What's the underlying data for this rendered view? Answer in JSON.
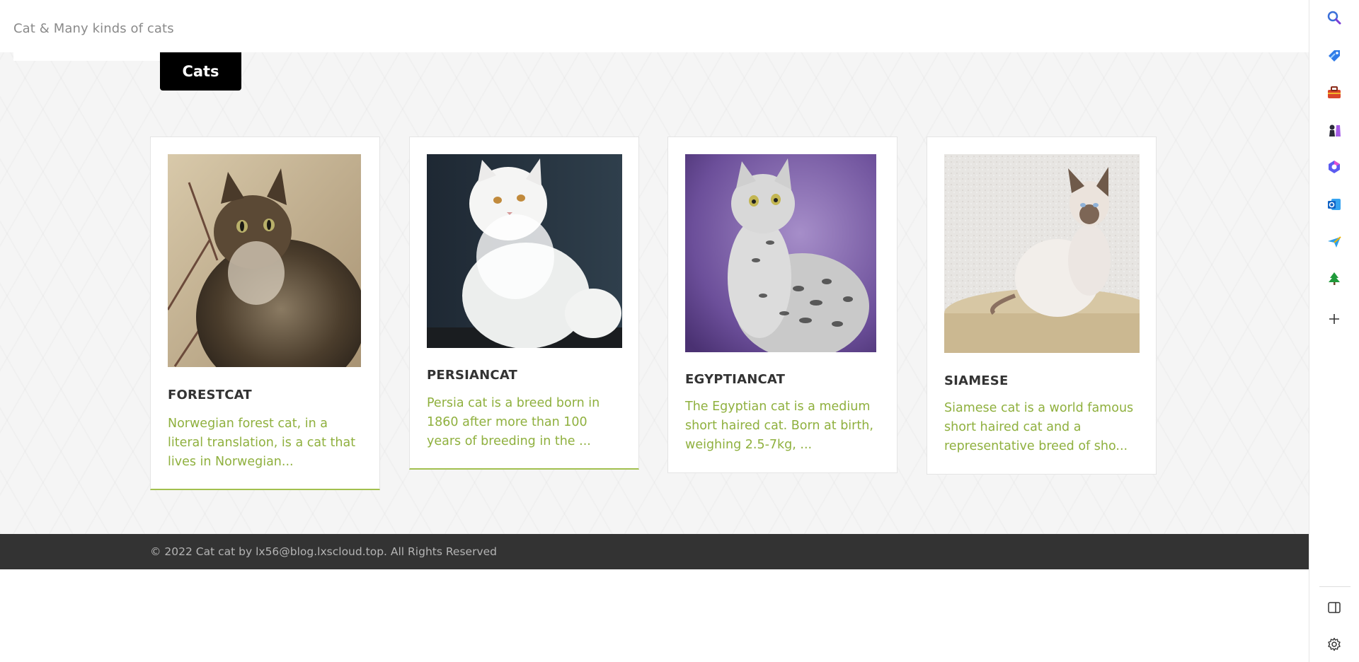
{
  "header": {
    "site_title": "Cat & Many kinds of cats"
  },
  "nav": {
    "category_tab": "Cats"
  },
  "cards": [
    {
      "title": "FORESTCAT",
      "desc": "Norwegian forest cat, in a literal translation, is a cat that lives in Norwegian..."
    },
    {
      "title": "PERSIANCAT",
      "desc": "Persia cat is a breed born in 1860 after more than 100 years of breeding in the ..."
    },
    {
      "title": "EGYPTIANCAT",
      "desc": "The Egyptian cat is a medium short haired cat. Born at birth, weighing 2.5-7kg, ..."
    },
    {
      "title": "SIAMESE",
      "desc": "Siamese cat is a world famous short haired cat and a representative breed of sho..."
    }
  ],
  "footer": {
    "text": "© 2022 Cat cat by lx56@blog.lxscloud.top. All Rights Reserved"
  },
  "sidebar": {
    "icons": [
      "search-icon",
      "tag-icon",
      "toolbox-icon",
      "chess-icon",
      "copilot-icon",
      "outlook-icon",
      "send-icon",
      "tree-icon",
      "plus-icon",
      "split-screen-icon",
      "gear-icon"
    ]
  },
  "colors": {
    "accent": "#8fb03e",
    "footer_bg": "#333333",
    "tab_bg": "#000000"
  }
}
